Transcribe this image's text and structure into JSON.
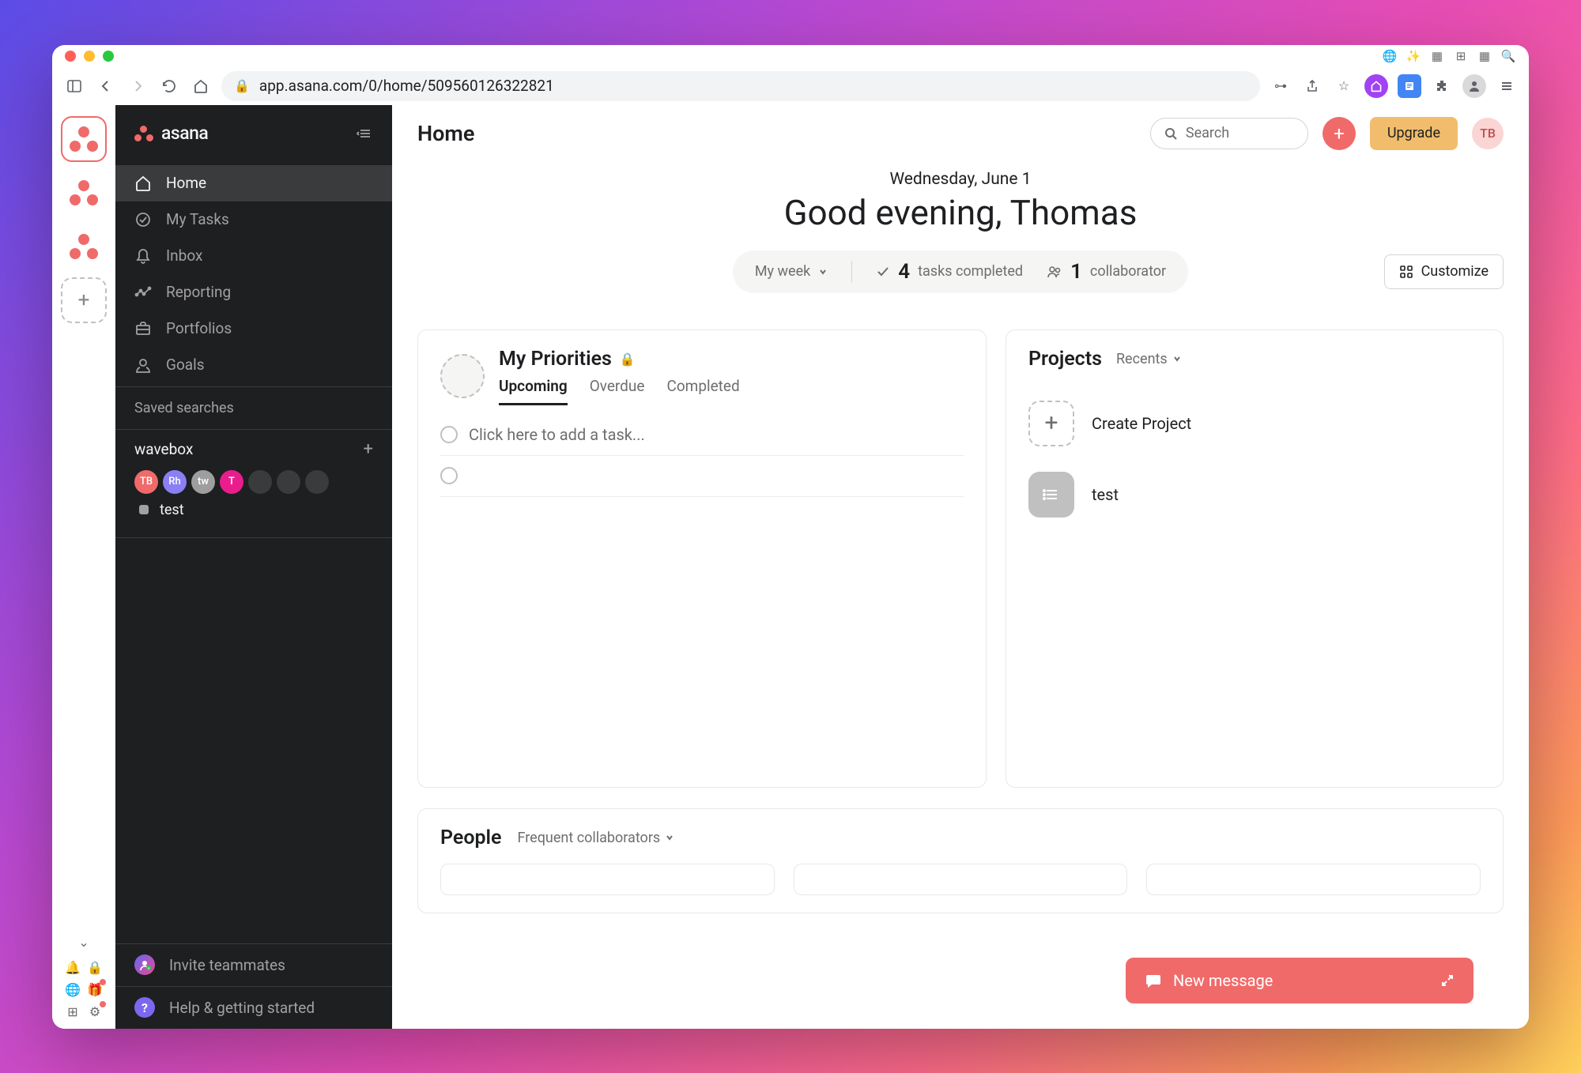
{
  "chrome": {
    "url": "app.asana.com/0/home/509560126322821"
  },
  "sidebar": {
    "brand": "asana",
    "nav": [
      {
        "label": "Home",
        "icon": "home"
      },
      {
        "label": "My Tasks",
        "icon": "check-circle"
      },
      {
        "label": "Inbox",
        "icon": "bell"
      },
      {
        "label": "Reporting",
        "icon": "chart"
      },
      {
        "label": "Portfolios",
        "icon": "briefcase"
      },
      {
        "label": "Goals",
        "icon": "target"
      }
    ],
    "saved_searches_label": "Saved searches",
    "team": {
      "name": "wavebox",
      "members": [
        {
          "initials": "TB",
          "bg": "#f06a6a"
        },
        {
          "initials": "Rh",
          "bg": "#8b7ff5"
        },
        {
          "initials": "tw",
          "bg": "#9e9e9e"
        },
        {
          "initials": "T",
          "bg": "#e91e8c"
        },
        {
          "initials": "",
          "bg": "#3a3b3d"
        },
        {
          "initials": "",
          "bg": "#3a3b3d"
        },
        {
          "initials": "",
          "bg": "#3a3b3d"
        }
      ],
      "project": "test"
    },
    "invite_label": "Invite teammates",
    "help_label": "Help & getting started"
  },
  "topbar": {
    "title": "Home",
    "search_placeholder": "Search",
    "upgrade_label": "Upgrade",
    "user_initials": "TB"
  },
  "hero": {
    "date": "Wednesday, June 1",
    "greeting": "Good evening, Thomas",
    "filter_label": "My week",
    "tasks_count": "4",
    "tasks_label": "tasks completed",
    "collab_count": "1",
    "collab_label": "collaborator",
    "customize_label": "Customize"
  },
  "priorities": {
    "title": "My Priorities",
    "tabs": [
      "Upcoming",
      "Overdue",
      "Completed"
    ],
    "add_task_placeholder": "Click here to add a task..."
  },
  "projects": {
    "title": "Projects",
    "filter": "Recents",
    "create_label": "Create Project",
    "items": [
      "test"
    ]
  },
  "people": {
    "title": "People",
    "filter": "Frequent collaborators"
  },
  "new_message_label": "New message"
}
